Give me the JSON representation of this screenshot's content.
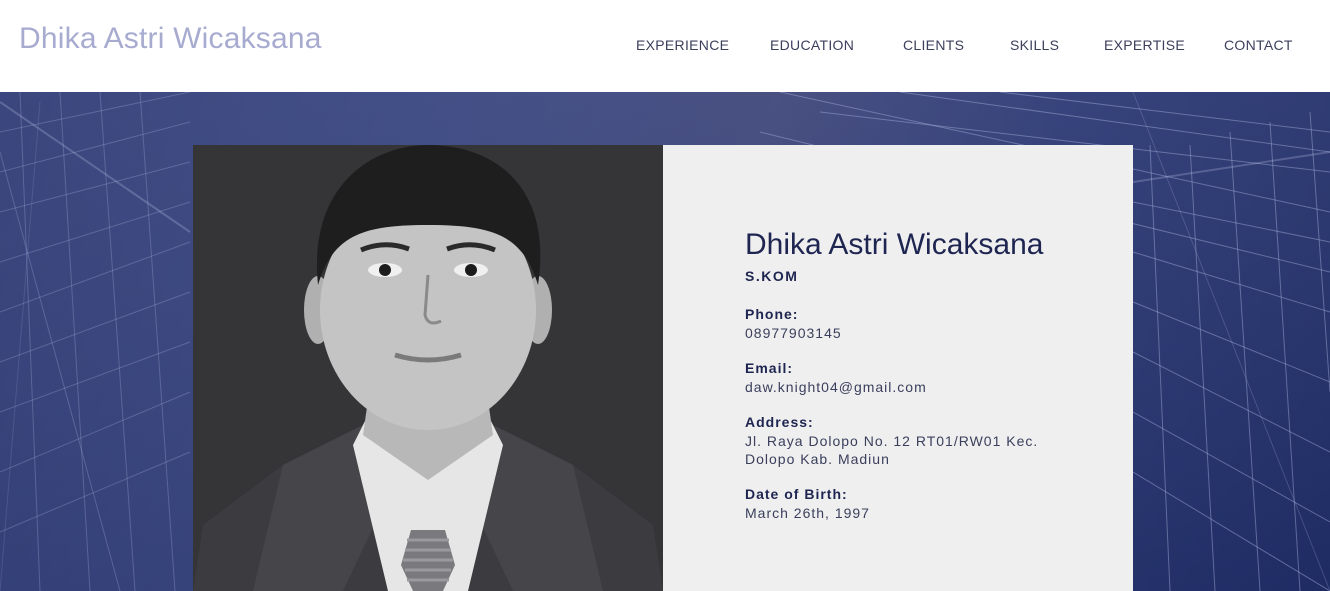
{
  "header": {
    "site_title": "Dhika Astri Wicaksana",
    "nav": [
      "EXPERIENCE",
      "EDUCATION",
      "CLIENTS",
      "SKILLS",
      "EXPERTISE",
      "CONTACT"
    ]
  },
  "profile": {
    "name": "Dhika Astri Wicaksana",
    "title": "S.KOM",
    "phone_label": "Phone:",
    "phone": "08977903145",
    "email_label": "Email:",
    "email": "daw.knight04@gmail.com",
    "address_label": "Address:",
    "address": "Jl. Raya Dolopo No. 12 RT01/RW01 Kec. Dolopo Kab. Madiun",
    "dob_label": "Date of Birth:",
    "dob": "March 26th, 1997"
  },
  "colors": {
    "title": "#a7abd0",
    "nav": "#3b3f5c",
    "hero_dark": "#2b3670",
    "panel": "#efefef",
    "ink": "#1e2550"
  }
}
